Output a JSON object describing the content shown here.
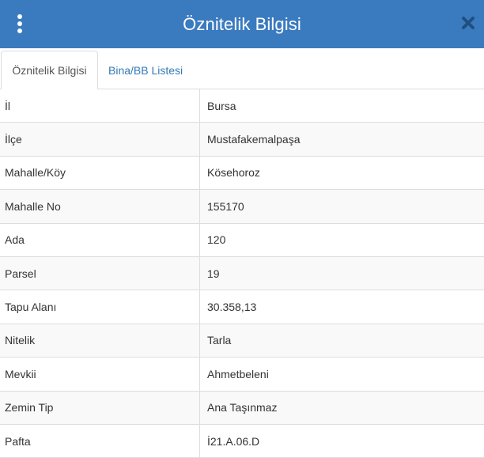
{
  "header": {
    "title": "Öznitelik Bilgisi",
    "background": "#3a7bbf"
  },
  "tabs": [
    {
      "label": "Öznitelik Bilgisi",
      "active": true
    },
    {
      "label": "Bina/BB Listesi",
      "active": false
    }
  ],
  "attributes": [
    {
      "key": "İl",
      "value": "Bursa"
    },
    {
      "key": "İlçe",
      "value": "Mustafakemalpaşa"
    },
    {
      "key": "Mahalle/Köy",
      "value": "Kösehoroz"
    },
    {
      "key": "Mahalle No",
      "value": "155170"
    },
    {
      "key": "Ada",
      "value": "120"
    },
    {
      "key": "Parsel",
      "value": "19"
    },
    {
      "key": "Tapu Alanı",
      "value": "30.358,13"
    },
    {
      "key": "Nitelik",
      "value": "Tarla"
    },
    {
      "key": "Mevkii",
      "value": "Ahmetbeleni"
    },
    {
      "key": "Zemin Tip",
      "value": "Ana Taşınmaz"
    },
    {
      "key": "Pafta",
      "value": "İ21.A.06.D"
    }
  ],
  "icons": {
    "menu": "vertical-ellipsis-icon",
    "close": "close-icon"
  }
}
